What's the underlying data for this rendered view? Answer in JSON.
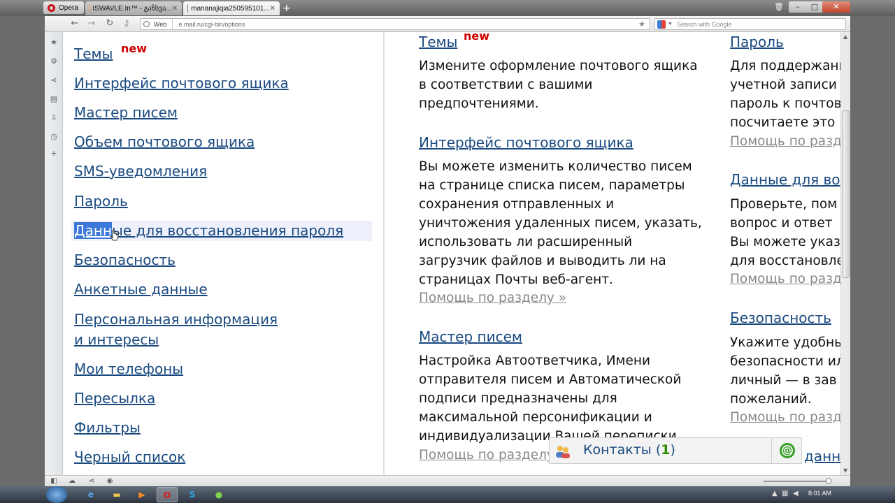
{
  "browser": {
    "opera_button": "Opera",
    "tabs": [
      {
        "label": "ISWAVLE.In™ - განსვა..."
      },
      {
        "label": "mananajiqia250595101..."
      }
    ],
    "address_bar": {
      "badge": "Web",
      "url": "e.mail.ru/cgi-bin/options",
      "search_placeholder": "Search with Google"
    }
  },
  "menu": {
    "new_badge": "new",
    "items": [
      {
        "label": "Темы"
      },
      {
        "label": "Интерфейс почтового ящика"
      },
      {
        "label": "Мастер писем"
      },
      {
        "label": "Объем почтового ящика"
      },
      {
        "label": "SMS-уведомления"
      },
      {
        "label": "Пароль"
      },
      {
        "label_selected": "Данн",
        "label_rest": "ые для восстановления пароля"
      },
      {
        "label": "Безопасность"
      },
      {
        "label": "Анкетные данные"
      },
      {
        "label_line1": "Персональная информация",
        "label_line2": "и интересы"
      },
      {
        "label": "Мои телефоны"
      },
      {
        "label": "Пересылка"
      },
      {
        "label": "Фильтры"
      },
      {
        "label": "Черный список"
      }
    ]
  },
  "column1": {
    "new_badge": "new",
    "sections": [
      {
        "title": "Темы",
        "description": "Измените оформление почтового ящика\nв соответствии с вашими\nпредпочтениями."
      },
      {
        "title": "Интерфейс почтового ящика",
        "description": "Вы можете изменить количество писем\nна странице списка писем, параметры\nсохранения отправленных и\nуничтожения удаленных писем, указать,\nиспользовать ли расширенный\nзагрузчик файлов и выводить ли на\nстраницах Почты веб-агент.",
        "help": "Помощь по разделу »"
      },
      {
        "title": "Мастер писем",
        "description": "Настройка Автоответчика, Имени\nотправителя писем и Автоматической\nподписи предназначены для\nмаксимальной персонификации и\nиндивидуализации Вашей переписки.",
        "help": "Помощь по разделу »"
      }
    ]
  },
  "column2": {
    "sections": [
      {
        "title": "Пароль",
        "description": "Для поддержани\nучетной записи \nпароль к почтов\nпосчитаете это н",
        "help": "Помощь по разд"
      },
      {
        "title": "Данные для во",
        "description": "Проверьте, пом\nвопрос и ответ \nВы можете указ\nдля восстановле",
        "help": "Помощь по разд"
      },
      {
        "title": "Безопасность",
        "description": "Укажите удобны\nбезопасности ил\nличный — в зав\nпожеланий.",
        "help": "Помощь по разд"
      },
      {
        "title": "данн"
      }
    ]
  },
  "contacts_widget": {
    "label": "Контакты",
    "open_paren": "(",
    "count": "1",
    "close_paren": ")"
  },
  "taskbar": {
    "time": "8:01 AM"
  },
  "colors": {
    "link": "#1a4a80",
    "new_badge": "#d00000",
    "help_link": "#888888",
    "selection": "#3c78d8"
  }
}
